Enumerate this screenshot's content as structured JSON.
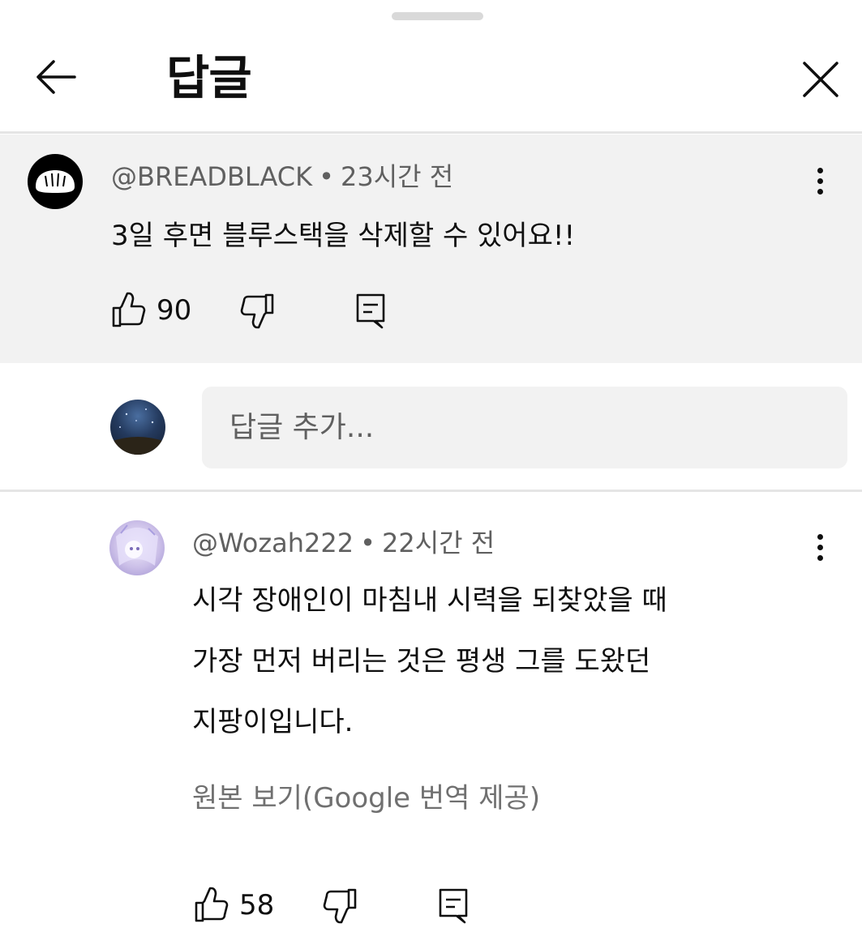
{
  "header": {
    "title": "답글"
  },
  "parent_comment": {
    "author": "@BREADBLACK",
    "separator": "•",
    "time": "23시간 전",
    "text": "3일 후면 블루스택을 삭제할 수 있어요!!",
    "likes": "90"
  },
  "reply_box": {
    "placeholder": "답글 추가..."
  },
  "reply": {
    "author": "@Wozah222",
    "separator": "•",
    "time": "22시간 전",
    "lines": [
      "시각 장애인이 마침내 시력을 되찾았을 때",
      "가장 먼저 버리는 것은 평생 그를 도왔던",
      "지팡이입니다."
    ],
    "translation_link": "원본 보기(Google 번역 제공)",
    "likes": "58"
  },
  "colors": {
    "background": "#ffffff",
    "parent_background": "#f2f2f2",
    "text": "#0f0f0f",
    "muted": "#606060",
    "divider": "#e5e5e5"
  },
  "icons": [
    "arrow-left-icon",
    "close-icon",
    "more-vert-icon",
    "thumb-up-icon",
    "thumb-down-icon",
    "reply-comment-icon"
  ]
}
